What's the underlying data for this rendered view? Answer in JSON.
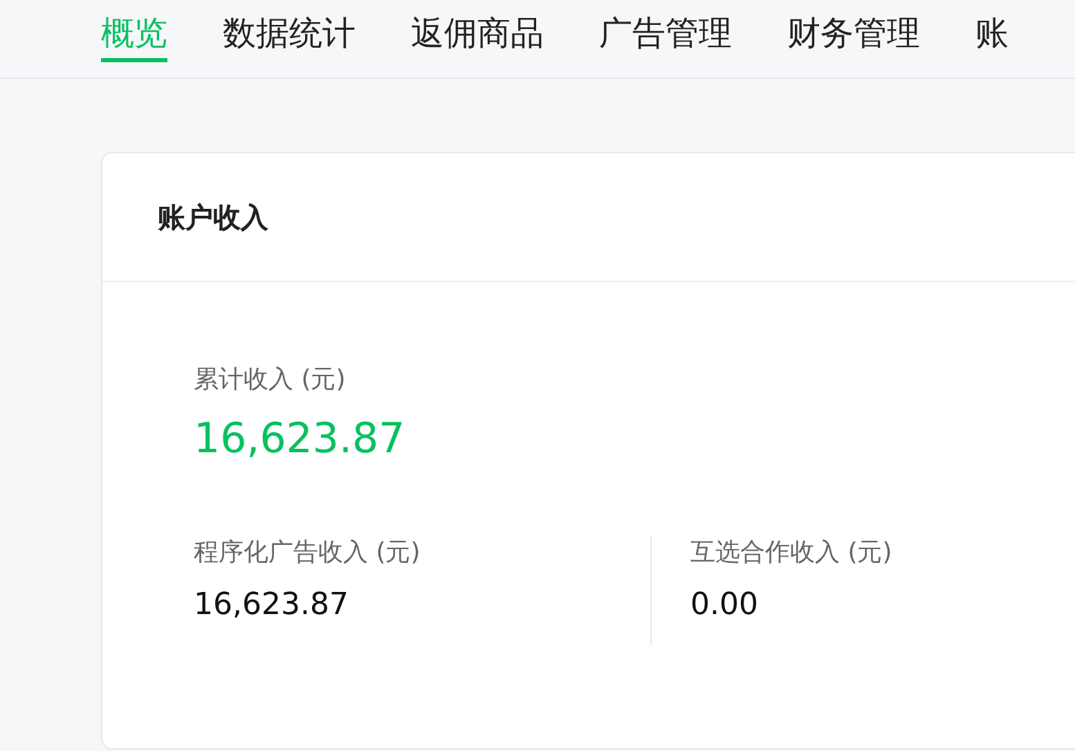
{
  "tabs": [
    {
      "label": "概览",
      "selected": true
    },
    {
      "label": "数据统计",
      "selected": false
    },
    {
      "label": "返佣商品",
      "selected": false
    },
    {
      "label": "广告管理",
      "selected": false
    },
    {
      "label": "财务管理",
      "selected": false
    },
    {
      "label": "账",
      "selected": false
    }
  ],
  "card": {
    "title": "账户收入",
    "total": {
      "label": "累计收入 (元)",
      "value": "16,623.87"
    },
    "breakdown": [
      {
        "label": "程序化广告收入 (元)",
        "value": "16,623.87"
      },
      {
        "label": "互选合作收入 (元)",
        "value": "0.00"
      }
    ]
  }
}
